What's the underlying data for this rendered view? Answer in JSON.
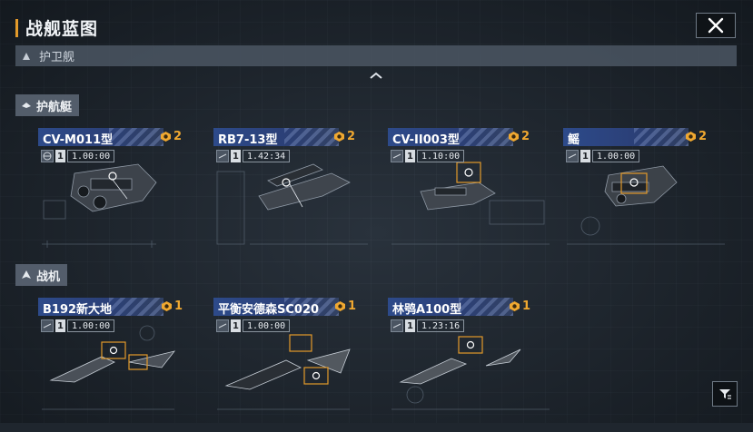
{
  "header": {
    "title": "战舰蓝图"
  },
  "category": {
    "label": "护卫舰"
  },
  "sections": [
    {
      "label": "护航艇",
      "cards": [
        {
          "name": "CV-M011型",
          "count": "2",
          "ratio_num": "1",
          "ratio": "1.00:00"
        },
        {
          "name": "RB7-13型",
          "count": "2",
          "ratio_num": "1",
          "ratio": "1.42:34"
        },
        {
          "name": "CV-II003型",
          "count": "2",
          "ratio_num": "1",
          "ratio": "1.10:00"
        },
        {
          "name": "鳐",
          "count": "2",
          "ratio_num": "1",
          "ratio": "1.00:00"
        }
      ]
    },
    {
      "label": "战机",
      "cards": [
        {
          "name": "B192新大地",
          "count": "1",
          "ratio_num": "1",
          "ratio": "1.00:00"
        },
        {
          "name": "平衡安德森SC020",
          "count": "1",
          "ratio_num": "1",
          "ratio": "1.00:00"
        },
        {
          "name": "林鸮A100型",
          "count": "1",
          "ratio_num": "1",
          "ratio": "1.23:16"
        }
      ]
    }
  ],
  "icons": {
    "close": "close-icon",
    "collapse": "chevron-up-icon",
    "filter": "filter-icon",
    "count": "blueprint-token-icon"
  },
  "colors": {
    "accent": "#e39a2a",
    "badge": "#f0a830",
    "title_bar": "#2d4a8a"
  }
}
